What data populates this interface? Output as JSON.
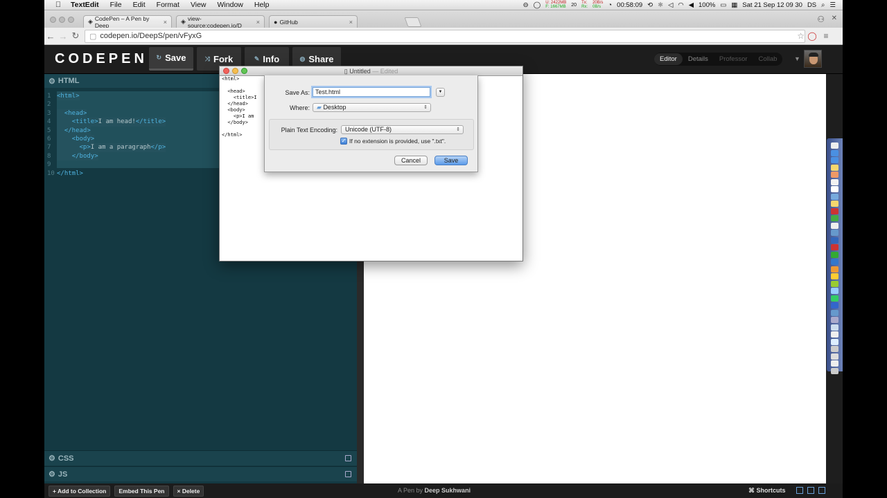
{
  "menubar": {
    "app_name": "TextEdit",
    "items": [
      "File",
      "Edit",
      "Format",
      "View",
      "Window",
      "Help"
    ],
    "mem_used": "U: 2422MB",
    "mem_free": "F: 1667MB",
    "cpu": "20",
    "net_tx": "Tx:",
    "net_rx": "Rx:",
    "net_tx_rate": "20B/s",
    "net_rx_rate": "0B/s",
    "timer": "00:58:09",
    "battery": "100%",
    "clock": "Sat 21 Sep  12 09 30",
    "user": "DS"
  },
  "browser": {
    "tabs": [
      {
        "label": "CodePen – A Pen by Deep",
        "close": "×"
      },
      {
        "label": "view-source:codepen.io/D",
        "close": "×"
      },
      {
        "label": "GitHub",
        "close": "×"
      }
    ],
    "url": "codepen.io/DeepS/pen/vFyxG"
  },
  "codepen": {
    "logo": "CODEPEN",
    "buttons": {
      "save": "Save",
      "fork": "Fork",
      "info": "Info",
      "share": "Share"
    },
    "views": {
      "editor": "Editor",
      "details": "Details",
      "professor": "Professor",
      "collab": "Collab"
    },
    "html_label": "HTML",
    "css_label": "CSS",
    "js_label": "JS",
    "code_lines": [
      {
        "n": "1",
        "parts": [
          [
            "tag",
            "<html>"
          ]
        ]
      },
      {
        "n": "2",
        "parts": []
      },
      {
        "n": "3",
        "parts": [
          [
            "txt",
            "  "
          ],
          [
            "tag",
            "<head>"
          ]
        ]
      },
      {
        "n": "4",
        "parts": [
          [
            "txt",
            "    "
          ],
          [
            "tag",
            "<title>"
          ],
          [
            "txt",
            "I am head!"
          ],
          [
            "tag",
            "</title>"
          ]
        ]
      },
      {
        "n": "5",
        "parts": [
          [
            "txt",
            "  "
          ],
          [
            "tag",
            "</head>"
          ]
        ]
      },
      {
        "n": "6",
        "parts": [
          [
            "txt",
            "    "
          ],
          [
            "tag",
            "<body>"
          ]
        ]
      },
      {
        "n": "7",
        "parts": [
          [
            "txt",
            "      "
          ],
          [
            "tag",
            "<p>"
          ],
          [
            "txt",
            "I am a paragraph"
          ],
          [
            "tag",
            "</p>"
          ]
        ]
      },
      {
        "n": "8",
        "parts": [
          [
            "txt",
            "    "
          ],
          [
            "tag",
            "</body>"
          ]
        ]
      },
      {
        "n": "9",
        "parts": []
      },
      {
        "n": "10",
        "parts": [
          [
            "tag",
            "</html>"
          ]
        ]
      }
    ],
    "footer": {
      "add_collection": "+ Add to Collection",
      "embed": "Embed This Pen",
      "delete": "× Delete",
      "credit_prefix": "A Pen by",
      "credit_author": "Deep Sukhwani",
      "shortcuts": "⌘ Shortcuts"
    }
  },
  "textedit": {
    "title": "Untitled",
    "edited": "— Edited",
    "body": "<html>\n\n  <head>\n    <title>I\n  </head>\n  <body>\n    <p>I am\n  </body>\n\n</html>"
  },
  "save_sheet": {
    "save_as_label": "Save As:",
    "filename": "Test.html",
    "where_label": "Where:",
    "where_value": "Desktop",
    "encoding_label": "Plain Text Encoding:",
    "encoding_value": "Unicode (UTF-8)",
    "extension_checkbox": "If no extension is provided, use \".txt\".",
    "extension_checked": true,
    "cancel": "Cancel",
    "save": "Save"
  },
  "colors": {
    "editor_bg": "#143942",
    "tag": "#4fb3e0",
    "save_button": "#5b9bea"
  }
}
